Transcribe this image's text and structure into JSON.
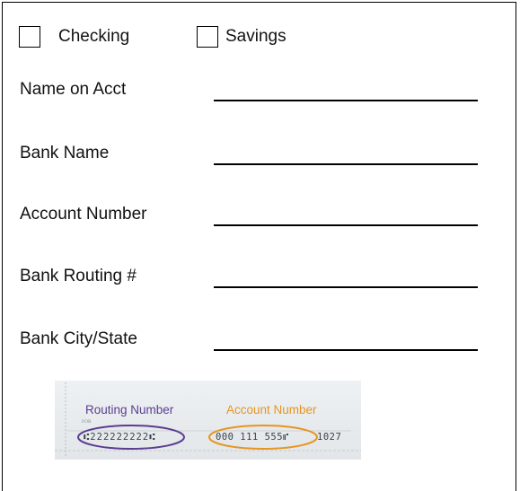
{
  "account_type": {
    "checking_label": "Checking",
    "savings_label": "Savings"
  },
  "fields": [
    {
      "label": "Name on Acct",
      "value": ""
    },
    {
      "label": "Bank Name",
      "value": ""
    },
    {
      "label": "Account Number",
      "value": ""
    },
    {
      "label": "Bank Routing #",
      "value": ""
    },
    {
      "label": "Bank City/State",
      "value": ""
    }
  ],
  "check_sample": {
    "routing_label": "Routing Number",
    "account_label": "Account Number",
    "for_label": "FOR",
    "routing_digits": "⑆222222222⑆",
    "account_digits": "000  111  555⑈",
    "check_number": "1027",
    "routing_color": "#5b3d8f",
    "account_color": "#e69520"
  }
}
